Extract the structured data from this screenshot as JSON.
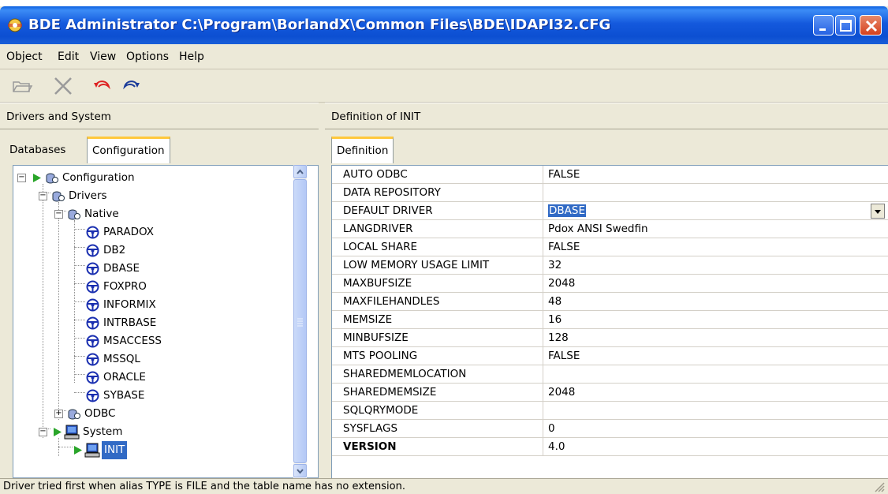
{
  "window": {
    "title": "BDE Administrator  C:\\Program\\BorlandX\\Common Files\\BDE\\IDAPI32.CFG"
  },
  "menu": [
    "Object",
    "Edit",
    "View",
    "Options",
    "Help"
  ],
  "toolbar": {
    "icons": [
      "open-icon",
      "delete-icon",
      "undo-icon",
      "redo-icon"
    ]
  },
  "left_panel": {
    "header": "Drivers and System",
    "tabs": [
      {
        "label": "Databases",
        "active": false
      },
      {
        "label": "Configuration",
        "active": true
      }
    ],
    "tree": [
      {
        "label": "Configuration",
        "level": 0,
        "expanded": true
      },
      {
        "label": "Drivers",
        "level": 1,
        "expanded": true
      },
      {
        "label": "Native",
        "level": 2,
        "expanded": true
      },
      {
        "label": "PARADOX",
        "level": 3
      },
      {
        "label": "DB2",
        "level": 3
      },
      {
        "label": "DBASE",
        "level": 3
      },
      {
        "label": "FOXPRO",
        "level": 3
      },
      {
        "label": "INFORMIX",
        "level": 3
      },
      {
        "label": "INTRBASE",
        "level": 3
      },
      {
        "label": "MSACCESS",
        "level": 3
      },
      {
        "label": "MSSQL",
        "level": 3
      },
      {
        "label": "ORACLE",
        "level": 3
      },
      {
        "label": "SYBASE",
        "level": 3
      },
      {
        "label": "ODBC",
        "level": 2,
        "expanded": false
      },
      {
        "label": "System",
        "level": 1,
        "expanded": true
      },
      {
        "label": "INIT",
        "level": 2,
        "selected": true
      }
    ]
  },
  "right_panel": {
    "header": "Definition of INIT",
    "tabs": [
      {
        "label": "Definition",
        "active": true
      }
    ],
    "rows": [
      {
        "name": "AUTO ODBC",
        "value": "FALSE"
      },
      {
        "name": "DATA REPOSITORY",
        "value": ""
      },
      {
        "name": "DEFAULT DRIVER",
        "value": "DBASE"
      },
      {
        "name": "LANGDRIVER",
        "value": "Pdox ANSI Swedfin"
      },
      {
        "name": "LOCAL SHARE",
        "value": "FALSE"
      },
      {
        "name": "LOW MEMORY USAGE LIMIT",
        "value": "32"
      },
      {
        "name": "MAXBUFSIZE",
        "value": "2048"
      },
      {
        "name": "MAXFILEHANDLES",
        "value": "48"
      },
      {
        "name": "MEMSIZE",
        "value": "16"
      },
      {
        "name": "MINBUFSIZE",
        "value": "128"
      },
      {
        "name": "MTS POOLING",
        "value": "FALSE"
      },
      {
        "name": "SHAREDMEMLOCATION",
        "value": ""
      },
      {
        "name": "SHAREDMEMSIZE",
        "value": "2048"
      },
      {
        "name": "SQLQRYMODE",
        "value": ""
      },
      {
        "name": "SYSFLAGS",
        "value": "0"
      },
      {
        "name": "VERSION",
        "value": "4.0"
      }
    ]
  },
  "status": {
    "text": "Driver tried first when alias TYPE is FILE and the table name has no extension."
  },
  "colors": {
    "titlebar": "#0c4fd2",
    "selection": "#316ac5",
    "face": "#ece9d8"
  }
}
